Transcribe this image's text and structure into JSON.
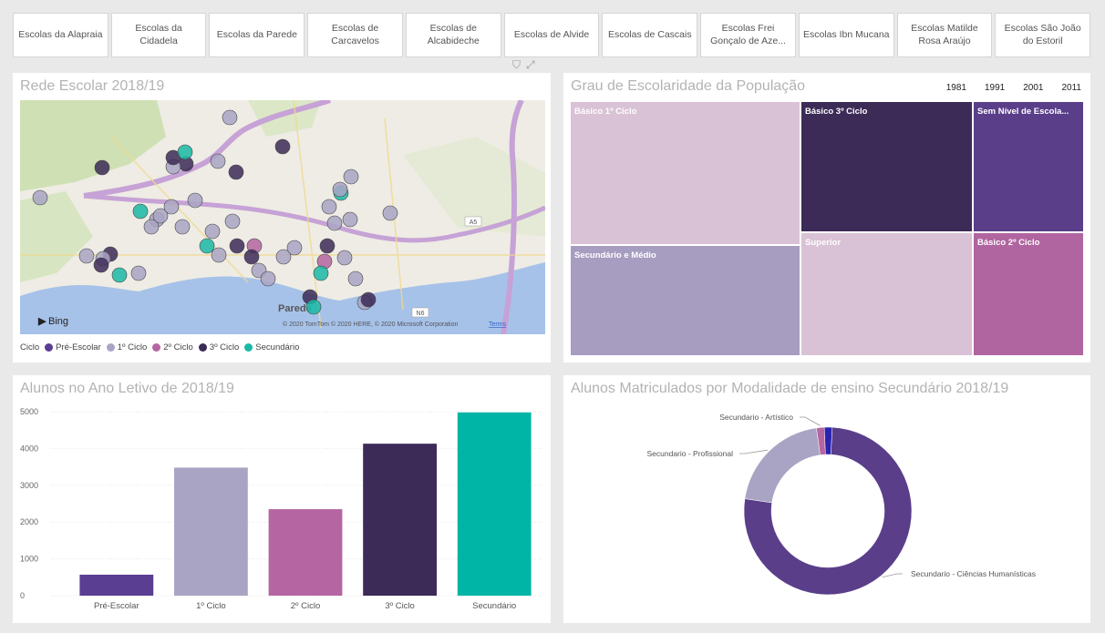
{
  "slicer": [
    {
      "label": "Escolas da Alapraia"
    },
    {
      "label": "Escolas da Cidadela"
    },
    {
      "label": "Escolas da Parede"
    },
    {
      "label": "Escolas de Carcavelos"
    },
    {
      "label": "Escolas de Alcabideche"
    },
    {
      "label": "Escolas de Alvide"
    },
    {
      "label": "Escolas de Cascais"
    },
    {
      "label": "Escolas Frei Gonçalo de Aze..."
    },
    {
      "label": "Escolas Ibn Mucana"
    },
    {
      "label": "Escolas Matilde Rosa Araújo"
    },
    {
      "label": "Escolas São João do Estoril"
    }
  ],
  "map": {
    "title": "Rede Escolar 2018/19",
    "bing_label": "Bing",
    "copyright": "© 2020 TomTom © 2020 HERE, © 2020 Microsoft Corporation",
    "terms": "Terms",
    "place_label": "Parede",
    "road_a5": "A5",
    "road_n6": "N6",
    "legend_title": "Ciclo",
    "legend": [
      {
        "label": "Pré-Escolar",
        "color": "#5a3e91"
      },
      {
        "label": "1º Ciclo",
        "color": "#a9a4c4"
      },
      {
        "label": "2º Ciclo",
        "color": "#b565a1"
      },
      {
        "label": "3º Ciclo",
        "color": "#3c2a57"
      },
      {
        "label": "Secundário",
        "color": "#1ab8a6"
      }
    ]
  },
  "treemap": {
    "title": "Grau de Escolaridade da População",
    "years": [
      "1981",
      "1991",
      "2001",
      "2011"
    ],
    "tiles": [
      {
        "label": "Básico 1º Ciclo",
        "color": "#d9c2d6"
      },
      {
        "label": "Secundário e Médio",
        "color": "#a69dc0"
      },
      {
        "label": "Básico 3º Ciclo",
        "color": "#3c2a57"
      },
      {
        "label": "Superior",
        "color": "#d9c2d6"
      },
      {
        "label": "Sem Nível de Escola...",
        "color": "#5a3e8a"
      },
      {
        "label": "Básico 2º Ciclo",
        "color": "#b165a0"
      }
    ]
  },
  "bar": {
    "title": "Alunos no Ano Letivo de 2018/19"
  },
  "donut": {
    "title": "Alunos Matriculados por Modalidade de ensino Secundário  2018/19"
  },
  "chart_data": [
    {
      "type": "bar",
      "title": "Alunos no Ano Letivo de 2018/19",
      "categories": [
        "Pré-Escolar",
        "1º Ciclo",
        "2º Ciclo",
        "3º Ciclo",
        "Secundário"
      ],
      "values": [
        570,
        3480,
        2350,
        4130,
        4980
      ],
      "colors": [
        "#5a3e91",
        "#a9a4c4",
        "#b565a1",
        "#3c2a57",
        "#00b5a6"
      ],
      "yticks": [
        0,
        1000,
        2000,
        3000,
        4000,
        5000
      ],
      "ylim": [
        0,
        5000
      ],
      "grid": true
    },
    {
      "type": "pie",
      "title": "Alunos Matriculados por Modalidade de ensino Secundário  2018/19",
      "donut": true,
      "series": [
        {
          "name": "Secundario - Ciências Humanísticas",
          "value": 76.5,
          "color": "#5a3e8a"
        },
        {
          "name": "Secundario - Profissional",
          "value": 20.5,
          "color": "#a9a4c4"
        },
        {
          "name": "Secundario - Artístico",
          "value": 1.5,
          "color": "#b565a1"
        },
        {
          "name": "",
          "value": 1.5,
          "color": "#2a24b0"
        }
      ]
    }
  ]
}
